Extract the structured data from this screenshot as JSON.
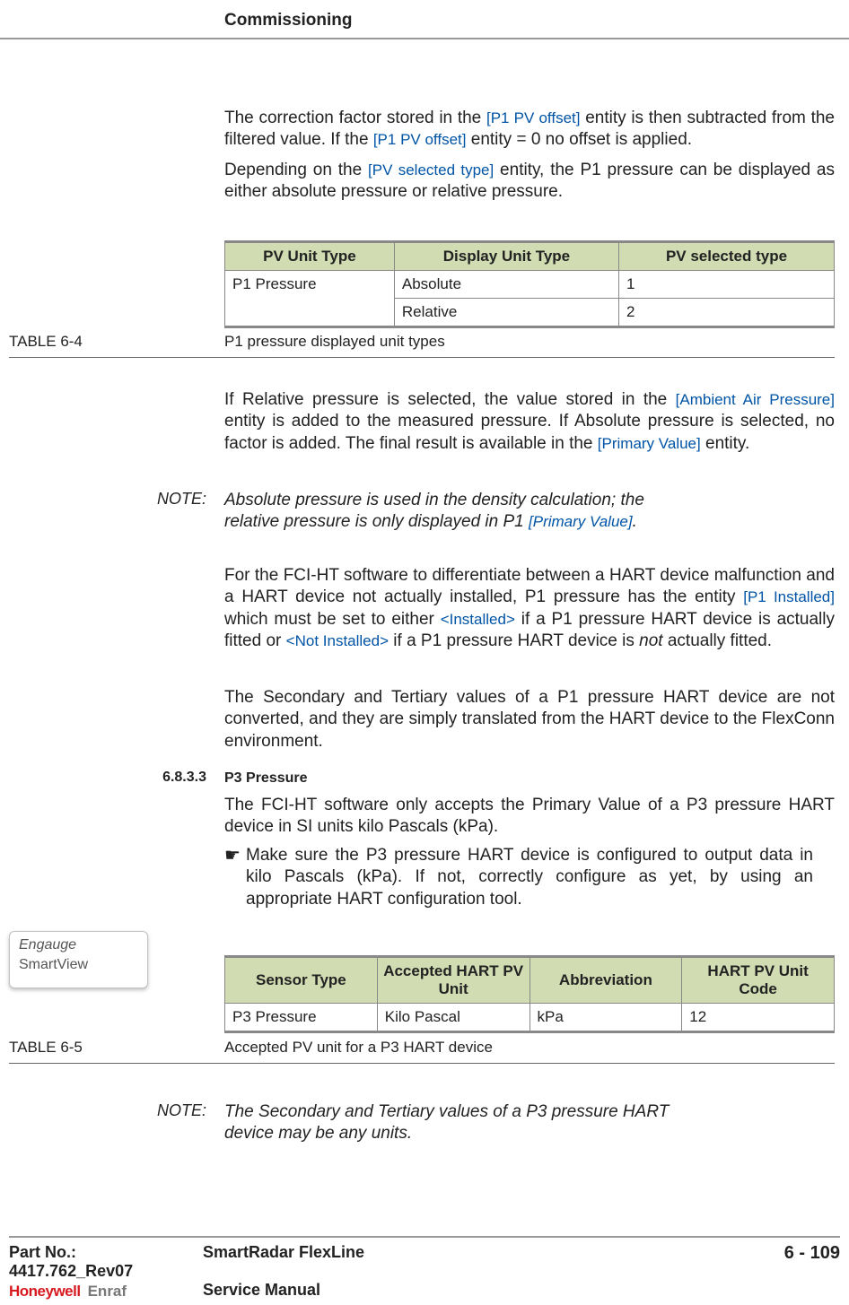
{
  "header_title": "Commissioning",
  "para1_a": "The correction factor stored in the ",
  "para1_e1": "[P1 PV offset]",
  "para1_b": " entity is then subtracted from the filtered value. If the ",
  "para1_e2": "[P1 PV offset]",
  "para1_c": " entity = 0 no offset is applied.",
  "para2_a": "Depending on the ",
  "para2_e1": "[PV selected type]",
  "para2_b": " entity, the P1 pressure can be displayed as either absolute pressure or relative pressure.",
  "t64": {
    "h1": "PV Unit Type",
    "h2": "Display Unit Type",
    "h3": "PV selected type",
    "r1c1": "P1 Pressure",
    "r1c2": "Absolute",
    "r1c3": "1",
    "r2c2": "Relative",
    "r2c3": "2",
    "label": "TABLE  6-4",
    "caption": "P1 pressure displayed unit types"
  },
  "para3_a": "If Relative pressure is selected, the value stored in the ",
  "para3_e1": "[Ambient Air Pressure]",
  "para3_b": " entity is added to the measured pressure. If Absolute pressure is selected, no factor is added. The final result is available in the ",
  "para3_e2": "[Primary Value]",
  "para3_c": " entity.",
  "note1_label": "NOTE:",
  "note1_a": "Absolute pressure is used in the density calculation; the relative pressure is only displayed in P1 ",
  "note1_e1": "[Primary Value]",
  "note1_b": ".",
  "para4_a": "For the FCI-HT software to differentiate between a HART device malfunction and a HART device not actually installed, P1 pressure has the entity ",
  "para4_e1": "[P1 Installed]",
  "para4_b": " which must be set to either ",
  "para4_e2": "<Installed>",
  "para4_c": " if a P1 pressure HART device is actually fitted or ",
  "para4_e3": "<Not Installed>",
  "para4_d": " if a P1 pressure HART device is ",
  "para4_not": "not",
  "para4_e": " actually fitted.",
  "para5": "The Secondary and Tertiary values of a P1 pressure HART device are not converted, and they are simply translated from the HART device to the FlexConn environment.",
  "sec_num": "6.8.3.3",
  "sec_title": "P3 Pressure",
  "para6": "The FCI-HT software only accepts the Primary Value of a P3 pressure HART device in SI units kilo Pascals (kPa).",
  "hand": "☛",
  "para7": "Make sure the P3 pressure HART device is configured to output data in kilo Pascals (kPa). If not, correctly configure as yet, by using an appropriate HART configuration tool.",
  "sv_l1": "Engauge",
  "sv_l2": "SmartView",
  "t65": {
    "h1": "Sensor Type",
    "h2": "Accepted HART PV Unit",
    "h3": "Abbreviation",
    "h4": "HART PV Unit Code",
    "r1c1": "P3 Pressure",
    "r1c2": "Kilo Pascal",
    "r1c3": "kPa",
    "r1c4": "12",
    "label": "TABLE  6-5",
    "caption": "Accepted PV unit for a P3 HART device"
  },
  "note2_label": "NOTE:",
  "note2": "The Secondary and Tertiary values of a P3 pressure HART device may be any units.",
  "footer": {
    "part": "Part No.: 4417.762_Rev07",
    "title": "SmartRadar FlexLine",
    "sub": "Service Manual",
    "page": "6 - 109",
    "brand1": "Honeywell",
    "brand2": "Enraf"
  }
}
